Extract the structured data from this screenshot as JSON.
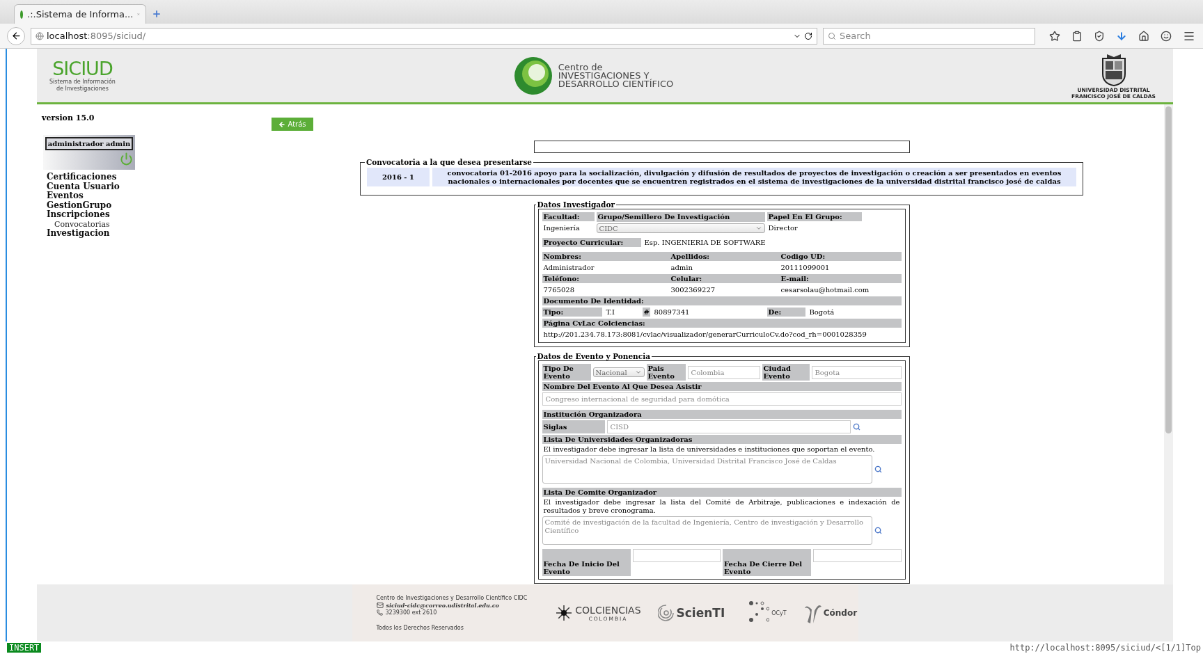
{
  "browser": {
    "tab_title": ".:.Sistema de Informa...",
    "url_host": "localhost",
    "url_rest": ":8095/siciud/",
    "search_placeholder": "Search"
  },
  "header": {
    "logo_title": "SICIUD",
    "logo_subtitle": [
      "Sistema de Información",
      "de Investigaciones"
    ],
    "center_title": [
      "Centro de",
      "INVESTIGACIONES Y",
      "DESARROLLO CIENTÍFICO"
    ],
    "emblem_caption": [
      "UNIVERSIDAD DISTRITAL",
      "FRANCISCO JOSÉ DE CALDAS"
    ]
  },
  "sidebar": {
    "version": "version 15.0",
    "user": "administrador admin",
    "menu": [
      {
        "label": "Certificaciones"
      },
      {
        "label": "Cuenta Usuario"
      },
      {
        "label": "Eventos"
      },
      {
        "label": "GestionGrupo"
      },
      {
        "label": "Inscripciones",
        "children": [
          {
            "label": "Convocatorias"
          }
        ]
      },
      {
        "label": "Investigacion"
      }
    ]
  },
  "back_button": "Atrás",
  "convocatoria": {
    "legend": "Convocatoria a la que desea presentarse",
    "period": "2016 - 1",
    "description": "convocatoria 01-2016 apoyo para la socialización, divulgación y difusión de resultados de proyectos de investigación o creación a ser presentados en eventos nacionales o internacionales por docentes que se encuentren registrados en el sistema de investigaciones de la universidad distrital francisco josé de caldas"
  },
  "investigador": {
    "legend": "Datos Investigador",
    "top_fields": [
      {
        "label": "Facultad:",
        "value": "Ingeniería",
        "kind": "text"
      },
      {
        "label": "Grupo/Semillero De Investigación",
        "value": "CIDC",
        "kind": "select"
      },
      {
        "label": "Papel En El Grupo:",
        "value": "Director",
        "kind": "text"
      }
    ],
    "proyecto": {
      "label": "Proyecto Curricular:",
      "value": "Esp. INGENIERIA DE SOFTWARE"
    },
    "person_rows": [
      [
        {
          "label": "Nombres:",
          "value": "Administrador"
        },
        {
          "label": "Apellidos:",
          "value": "admin"
        },
        {
          "label": "Codigo UD:",
          "value": "20111099001"
        }
      ],
      [
        {
          "label": "Teléfono:",
          "value": "7765028"
        },
        {
          "label": "Celular:",
          "value": "3002369227"
        },
        {
          "label": "E-mail:",
          "value": "cesarsolau@hotmail.com"
        }
      ]
    ],
    "documento": {
      "heading": "Documento De Identidad:",
      "fields": [
        {
          "label": "Tipo:",
          "value": "T.I"
        },
        {
          "label": "#",
          "value": "80897341"
        },
        {
          "label": "De:",
          "value": "Bogotá"
        }
      ]
    },
    "cvlac": {
      "heading": "Página CvLac Colciencias:",
      "value": "http://201.234.78.173:8081/cvlac/visualizador/generarCurriculoCv.do?cod_rh=0001028359"
    }
  },
  "evento": {
    "legend": "Datos de Evento y Ponencia",
    "tipo": {
      "label": "Tipo De Evento",
      "value": "Nacional"
    },
    "pais": {
      "label": "Pais Evento",
      "value": "Colombia"
    },
    "ciudad": {
      "label": "Ciudad Evento",
      "value": "Bogota"
    },
    "nombre": {
      "heading": "Nombre Del Evento Al Que Desea Asistir",
      "value": "Congreso internacional de seguridad para domótica"
    },
    "institucion": {
      "heading": "Institución Organizadora",
      "label": "Siglas",
      "value": "CISD"
    },
    "universidades": {
      "heading": "Lista De Universidades Organizadoras",
      "note": "El investigador debe ingresar la lista de universidades e instituciones que soportan el evento.",
      "value": "Universidad Nacional de Colombia, Universidad Distrital Francisco José de Caldas"
    },
    "comite": {
      "heading": "Lista De Comite Organizador",
      "note": "El investigador debe ingresar la lista del Comité de Arbitraje, publicaciones e indexación de resultados y breve cronograma.",
      "value": "Comité de investigación de la facultad de Ingeniería, Centro de investigación y Desarrollo Científico"
    },
    "fechas": [
      {
        "label": "Fecha De Inicio Del Evento"
      },
      {
        "label": "Fecha De Cierre Del Evento"
      }
    ]
  },
  "footer": {
    "org": "Centro de Investigaciones y Desarrollo Científico CIDC",
    "email": "siciud-cidc@correo.udistrital.edu.co",
    "phone": "3239300 ext 2610",
    "rights": "Todos los Derechos Reservados",
    "logos": [
      {
        "kind": "colciencias",
        "name": "COLCIENCIAS",
        "sub": "COLOMBIA"
      },
      {
        "kind": "scienti",
        "name": "ScienTI"
      },
      {
        "kind": "ocyt",
        "name": "OCyT"
      },
      {
        "kind": "condor",
        "name": "Cóndor"
      }
    ]
  },
  "status_bar": {
    "mode": "INSERT",
    "info": "http://localhost:8095/siciud/<[1/1]Top"
  }
}
